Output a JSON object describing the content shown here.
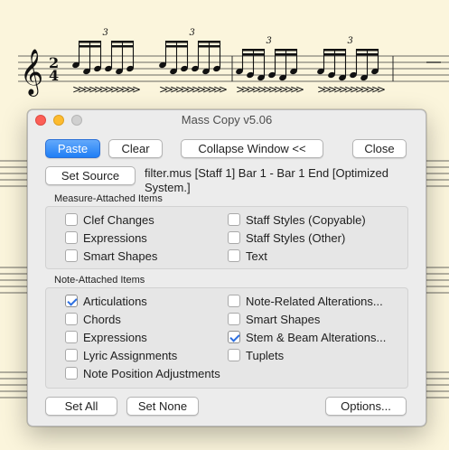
{
  "window": {
    "title": "Mass Copy v5.06"
  },
  "score": {
    "time_sig_top": "2",
    "time_sig_bottom": "4",
    "tuplet": "3",
    "accent": ">"
  },
  "toolbar": {
    "paste_label": "Paste",
    "clear_label": "Clear",
    "collapse_label": "Collapse Window <<",
    "close_label": "Close"
  },
  "source": {
    "set_source_label": "Set Source",
    "text": "filter.mus [Staff 1] Bar 1 - Bar 1 End [Optimized System.]"
  },
  "measure_attached": {
    "label": "Measure-Attached Items",
    "items": [
      {
        "label": "Clef Changes",
        "checked": false
      },
      {
        "label": "Expressions",
        "checked": false
      },
      {
        "label": "Smart Shapes",
        "checked": false
      },
      {
        "label": "Staff Styles (Copyable)",
        "checked": false
      },
      {
        "label": "Staff Styles (Other)",
        "checked": false
      },
      {
        "label": "Text",
        "checked": false
      }
    ]
  },
  "note_attached": {
    "label": "Note-Attached Items",
    "items": [
      {
        "label": "Articulations",
        "checked": true
      },
      {
        "label": "Chords",
        "checked": false
      },
      {
        "label": "Expressions",
        "checked": false
      },
      {
        "label": "Lyric Assignments",
        "checked": false
      },
      {
        "label": "Note Position Adjustments",
        "checked": false
      },
      {
        "label": "Note-Related Alterations...",
        "checked": false
      },
      {
        "label": "Smart Shapes",
        "checked": false
      },
      {
        "label": "Stem & Beam Alterations...",
        "checked": true
      },
      {
        "label": "Tuplets",
        "checked": false
      }
    ]
  },
  "footer": {
    "set_all_label": "Set All",
    "set_none_label": "Set None",
    "options_label": "Options..."
  }
}
